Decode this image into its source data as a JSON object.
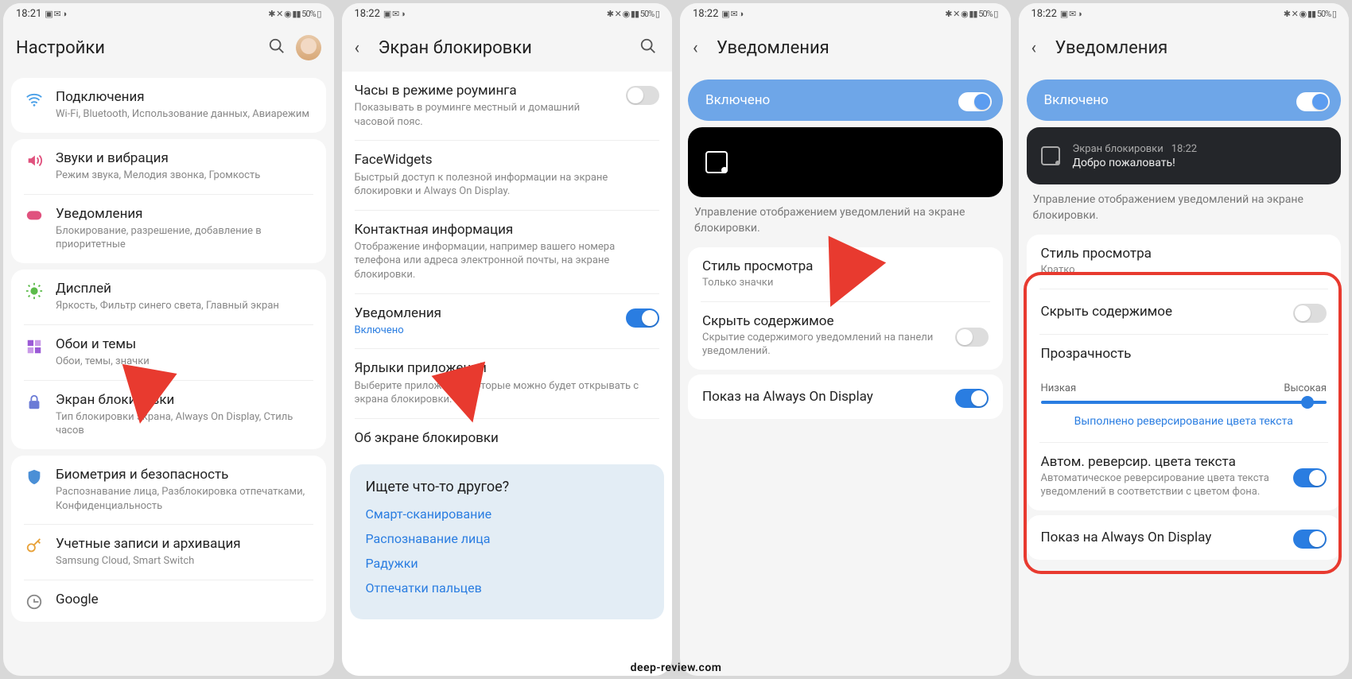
{
  "watermark": "deep-review.com",
  "battery": "50%",
  "screens": [
    {
      "time": "18:21",
      "title": "Настройки",
      "groups": [
        [
          {
            "icon": "wifi",
            "color": "#4aa0e8",
            "title": "Подключения",
            "sub": "Wi-Fi, Bluetooth, Использование данных, Авиарежим"
          }
        ],
        [
          {
            "icon": "sound",
            "color": "#e0527e",
            "title": "Звуки и вибрация",
            "sub": "Режим звука, Мелодия звонка, Громкость"
          },
          {
            "icon": "notif",
            "color": "#e0527e",
            "title": "Уведомления",
            "sub": "Блокирование, разрешение, добавление в приоритетные"
          }
        ],
        [
          {
            "icon": "display",
            "color": "#5cbb4a",
            "title": "Дисплей",
            "sub": "Яркость, Фильтр синего света, Главный экран"
          },
          {
            "icon": "wallpaper",
            "color": "#9b5ad6",
            "title": "Обои и темы",
            "sub": "Обои, темы, значки"
          },
          {
            "icon": "lock",
            "color": "#6a7ad6",
            "title": "Экран блокировки",
            "sub": "Тип блокировки экрана, Always On Display, Стиль часов"
          }
        ],
        [
          {
            "icon": "shield",
            "color": "#4a8fd6",
            "title": "Биометрия и безопасность",
            "sub": "Распознавание лица, Разблокировка отпечатками, Конфиденциальность"
          },
          {
            "icon": "key",
            "color": "#e8a23a",
            "title": "Учетные записи и архивация",
            "sub": "Samsung Cloud, Smart Switch"
          },
          {
            "icon": "google",
            "color": "#e8a23a",
            "title": "Google",
            "sub": ""
          }
        ]
      ]
    },
    {
      "time": "18:22",
      "title": "Экран блокировки",
      "items": [
        {
          "title": "Часы в режиме роуминга",
          "sub": "Показывать в роуминге местный и домашний часовой пояс.",
          "toggle": false
        },
        {
          "title": "FaceWidgets",
          "sub": "Быстрый доступ к полезной информации на экране блокировки и Always On Display."
        },
        {
          "title": "Контактная информация",
          "sub": "Отображение информации, например вашего номера телефона или адреса электронной почты, на экране блокировки."
        },
        {
          "title": "Уведомления",
          "sub": "Включено",
          "subblue": true,
          "toggle": true
        },
        {
          "title": "Ярлыки приложений",
          "sub": "Выберите приложения, которые можно будет открывать с экрана блокировки."
        },
        {
          "title": "Об экране блокировки",
          "sub": ""
        }
      ],
      "search_panel": {
        "q": "Ищете что-то другое?",
        "links": [
          "Смарт-сканирование",
          "Распознавание лица",
          "Радужки",
          "Отпечатки пальцев"
        ]
      }
    },
    {
      "time": "18:22",
      "title": "Уведомления",
      "enabled": "Включено",
      "desc": "Управление отображением уведомлений на экране блокировки.",
      "items": [
        {
          "title": "Стиль просмотра",
          "sub": "Только значки"
        },
        {
          "title": "Скрыть содержимое",
          "sub": "Скрытие содержимого уведомлений на панели уведомлений.",
          "toggle": false
        },
        {
          "title": "Показ на Always On Display",
          "toggle": true
        }
      ]
    },
    {
      "time": "18:22",
      "title": "Уведомления",
      "enabled": "Включено",
      "preview": {
        "app": "Экран блокировки",
        "time": "18:22",
        "msg": "Добро пожаловать!"
      },
      "desc": "Управление отображением уведомлений на экране блокировки.",
      "items": [
        {
          "title": "Стиль просмотра",
          "sub": "Кратко"
        },
        {
          "title": "Скрыть содержимое",
          "toggle": false
        },
        {
          "title": "Прозрачность",
          "slider": true,
          "low": "Низкая",
          "high": "Высокая",
          "note": "Выполнено реверсирование цвета текста"
        },
        {
          "title": "Автом. реверсир. цвета текста",
          "sub": "Автоматическое реверсирование цвета текста уведомлений в соответствии с цветом фона.",
          "toggle": true
        },
        {
          "title": "Показ на Always On Display",
          "toggle": true
        }
      ]
    }
  ]
}
